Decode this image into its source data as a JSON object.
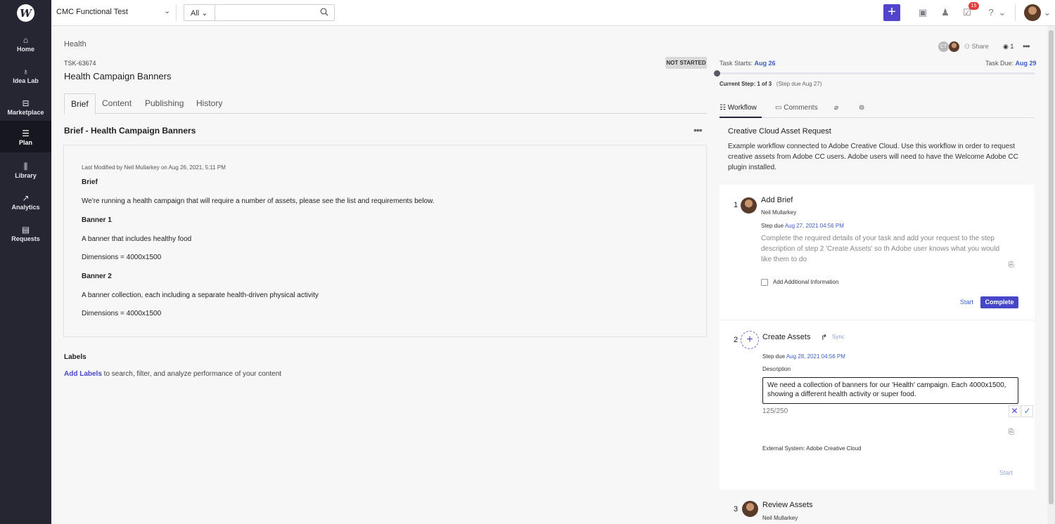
{
  "nav": {
    "logo": "W",
    "items": [
      {
        "label": "Home",
        "icon": "home-icon"
      },
      {
        "label": "Idea Lab",
        "icon": "bulb-icon"
      },
      {
        "label": "Marketplace",
        "icon": "store-icon"
      },
      {
        "label": "Plan",
        "icon": "list-icon"
      },
      {
        "label": "Library",
        "icon": "library-icon"
      },
      {
        "label": "Analytics",
        "icon": "chart-icon"
      },
      {
        "label": "Requests",
        "icon": "document-icon"
      }
    ]
  },
  "topbar": {
    "workspace": "CMC Functional Test",
    "search_scope": "All",
    "search_value": "",
    "notification_count": "15"
  },
  "task": {
    "breadcrumb": "Health",
    "id": "TSK-63674",
    "status": "NOT STARTED",
    "title": "Health Campaign Banners",
    "tabs": [
      "Brief",
      "Content",
      "Publishing",
      "History"
    ]
  },
  "brief": {
    "heading": "Brief - Health Campaign Banners",
    "modified": "Last Modified by Neil Mullarkey on Aug 26, 2021, 5:11 PM",
    "lines": [
      "Brief",
      "We're running a health campaign that will require a number of assets, please see the list and requirements below.",
      "Banner 1",
      "A banner that includes healthy food",
      "Dimensions = 4000x1500",
      "Banner 2",
      "A banner collection, each including a separate health-driven physical activity",
      "Dimensions = 4000x1500"
    ]
  },
  "labels": {
    "title": "Labels",
    "link": "Add Labels",
    "text": " to search, filter, and analyze performance of your content"
  },
  "header_right": {
    "collab_initials": "CT",
    "share": "Share",
    "views": "1"
  },
  "timeline": {
    "starts_label": "Task Starts: ",
    "starts_date": "Aug 26",
    "due_label": "Task Due: ",
    "due_date": "Aug 29",
    "progress": 0,
    "current_step": "Current Step: 1 of 3",
    "step_due": "(Step due Aug 27)"
  },
  "right_tabs": {
    "workflow": "Workflow",
    "comments": "Comments"
  },
  "workflow": {
    "title": "Creative Cloud Asset Request",
    "description": "Example workflow connected to Adobe Creative Cloud. Use this workflow in order to request creative assets from Adobe CC users. Adobe users will need to have the Welcome Adobe CC plugin installed.",
    "steps": [
      {
        "num": "1",
        "title": "Add Brief",
        "assignee": "Neil Mullarkey",
        "due_label": "Step due ",
        "due": "Aug 27, 2021 04:56 PM",
        "description": "Complete the required details of your task and add your request to the step description of step 2 'Create Assets' so th Adobe user knows what you would like them to do",
        "checkbox_label": "Add Additional Information",
        "start": "Start",
        "complete": "Complete"
      },
      {
        "num": "2",
        "title": "Create Assets",
        "sync": "Sync",
        "due_label": "Step due ",
        "due": "Aug 28, 2021 04:56 PM",
        "desc_label": "Description",
        "desc_value": "We need a collection of banners for our 'Health' campaign. Each 4000x1500, showing a different health activity or super food.",
        "char_count": "125/250",
        "external": "External System: Adobe Creative Cloud",
        "start": "Start"
      },
      {
        "num": "3",
        "title": "Review Assets",
        "assignee": "Neil Mullarkey"
      }
    ]
  }
}
